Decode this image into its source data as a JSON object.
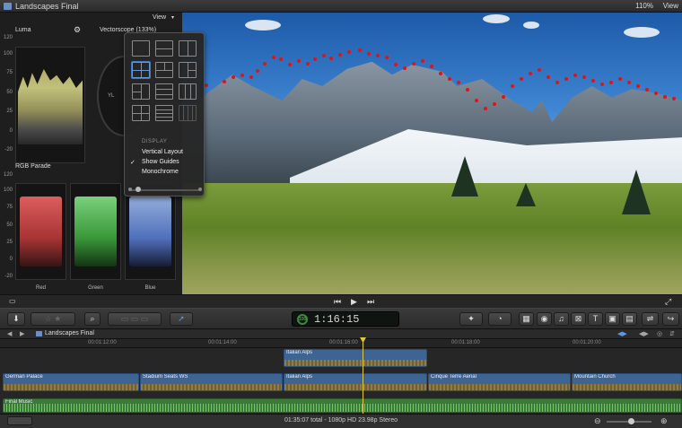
{
  "window": {
    "title": "Landscapes Final",
    "zoom": "110%",
    "view_menu": "View"
  },
  "scopes": {
    "view_menu": "View",
    "luma": {
      "title": "Luma",
      "axis": [
        "120",
        "100",
        "75",
        "50",
        "25",
        "0",
        "-20"
      ]
    },
    "vectorscope": {
      "title": "Vectorscope (133%)",
      "marker": "YL"
    },
    "rgb_parade": {
      "title": "RGB Parade",
      "axis": [
        "120",
        "100",
        "75",
        "50",
        "25",
        "0",
        "-20"
      ],
      "channels": [
        "Red",
        "Green",
        "Blue"
      ]
    }
  },
  "view_popover": {
    "section": "DISPLAY",
    "items": [
      {
        "label": "Vertical Layout",
        "checked": false
      },
      {
        "label": "Show Guides",
        "checked": true
      },
      {
        "label": "Monochrome",
        "checked": false
      }
    ],
    "check_glyph": "✓"
  },
  "transport": {
    "prev": "⏮",
    "play": "▶",
    "next": "⏭"
  },
  "toolbar": {
    "timecode": "1:16:15",
    "timecode_ring": "100"
  },
  "timeline": {
    "project": "Landscapes Final",
    "ruler": [
      "00:01:12:00",
      "00:01:14:00",
      "00:01:16:00",
      "00:01:18:00",
      "00:01:20:00"
    ],
    "clips": [
      {
        "name": "Italian Alps",
        "lane": "connected"
      },
      {
        "name": "German Palace",
        "lane": "primary"
      },
      {
        "name": "Stadium Seats WS",
        "lane": "primary"
      },
      {
        "name": "Italian Alps",
        "lane": "primary"
      },
      {
        "name": "Cinque Terre Aerial",
        "lane": "primary"
      },
      {
        "name": "Mountain Church",
        "lane": "primary"
      },
      {
        "name": "Final Music",
        "lane": "music"
      }
    ]
  },
  "status": {
    "info": "01:35:07 total - 1080p HD 23.98p Stereo"
  },
  "colors": {
    "accent": "#5c9be6",
    "guide": "#e01414",
    "playhead": "#e4c64b",
    "clip": "#3e6493",
    "music_clip": "#3c7a3a"
  }
}
